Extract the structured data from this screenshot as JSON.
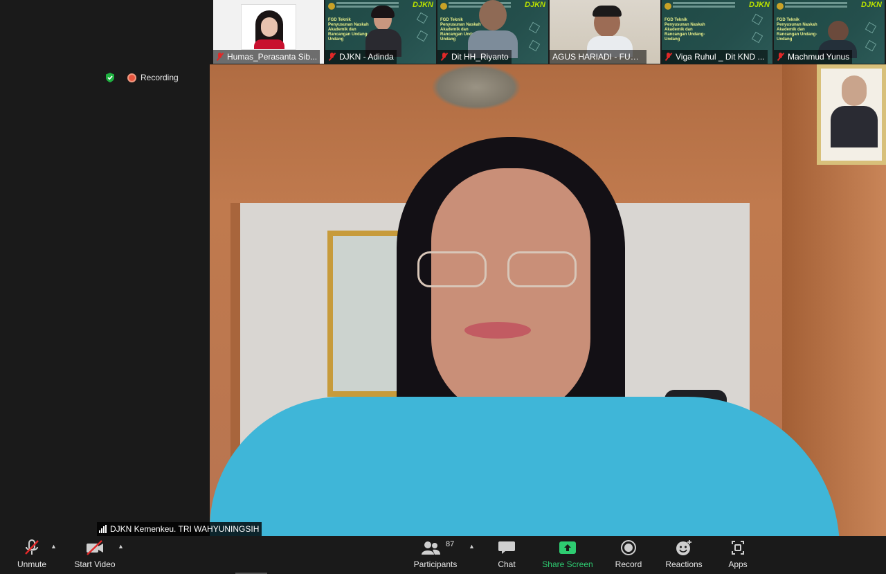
{
  "participants": [
    {
      "name": "Humas_Perasanta Sib...",
      "muted": true,
      "kind": "photo"
    },
    {
      "name": "DJKN - Adinda",
      "muted": true,
      "kind": "slide"
    },
    {
      "name": "Dit HH_Riyanto",
      "muted": true,
      "kind": "slide"
    },
    {
      "name": "AGUS HARIADI - FUNSIO...",
      "muted": false,
      "kind": "office"
    },
    {
      "name": "Viga Ruhul _ Dit KND ...",
      "muted": true,
      "kind": "slide"
    },
    {
      "name": "Machmud Yunus",
      "muted": true,
      "kind": "slide"
    }
  ],
  "slide": {
    "brand": "DJKN",
    "text": "FGD Teknik Penyusunan Naskah Akademik dan Rancangan Undang-Undang"
  },
  "status": {
    "recording_label": "Recording"
  },
  "active_speaker": {
    "name": "DJKN Kemenkeu. TRI WAHYUNINGSIH"
  },
  "toolbar": {
    "unmute": "Unmute",
    "start_video": "Start Video",
    "participants": "Participants",
    "participants_count": "87",
    "chat": "Chat",
    "share_screen": "Share Screen",
    "record": "Record",
    "reactions": "Reactions",
    "apps": "Apps"
  },
  "colors": {
    "accent_green": "#2ecc71",
    "recording_red": "#e8563f",
    "muted_red": "#e02828",
    "background": "#1a1a1a"
  },
  "icons": [
    "shield-check-icon",
    "recording-dot-icon",
    "mic-muted-icon",
    "video-off-icon",
    "participants-icon",
    "chat-icon",
    "share-screen-icon",
    "record-icon",
    "reactions-icon",
    "apps-icon",
    "signal-icon"
  ]
}
